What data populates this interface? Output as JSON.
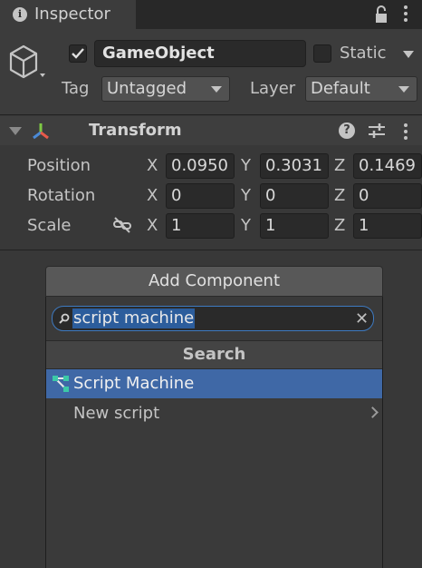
{
  "tab": {
    "title": "Inspector"
  },
  "gameobject": {
    "active": true,
    "name": "GameObject",
    "static_label": "Static",
    "static_checked": false,
    "tag_label": "Tag",
    "tag_value": "Untagged",
    "layer_label": "Layer",
    "layer_value": "Default"
  },
  "transform": {
    "title": "Transform",
    "position": {
      "label": "Position",
      "x": "0.0950",
      "y": "0.3031",
      "z": "0.1469"
    },
    "rotation": {
      "label": "Rotation",
      "x": "0",
      "y": "0",
      "z": "0"
    },
    "scale": {
      "label": "Scale",
      "x": "1",
      "y": "1",
      "z": "1"
    },
    "axes": {
      "x": "X",
      "y": "Y",
      "z": "Z"
    }
  },
  "add_component": {
    "button_label": "Add Component",
    "search_value": "script machine",
    "section_title": "Search",
    "items": [
      {
        "label": "Script Machine",
        "selected": true
      },
      {
        "label": "New script",
        "selected": false
      }
    ]
  },
  "colors": {
    "selection": "#3f68a6",
    "search_focus": "#3e7ac1",
    "background": "#383838"
  }
}
